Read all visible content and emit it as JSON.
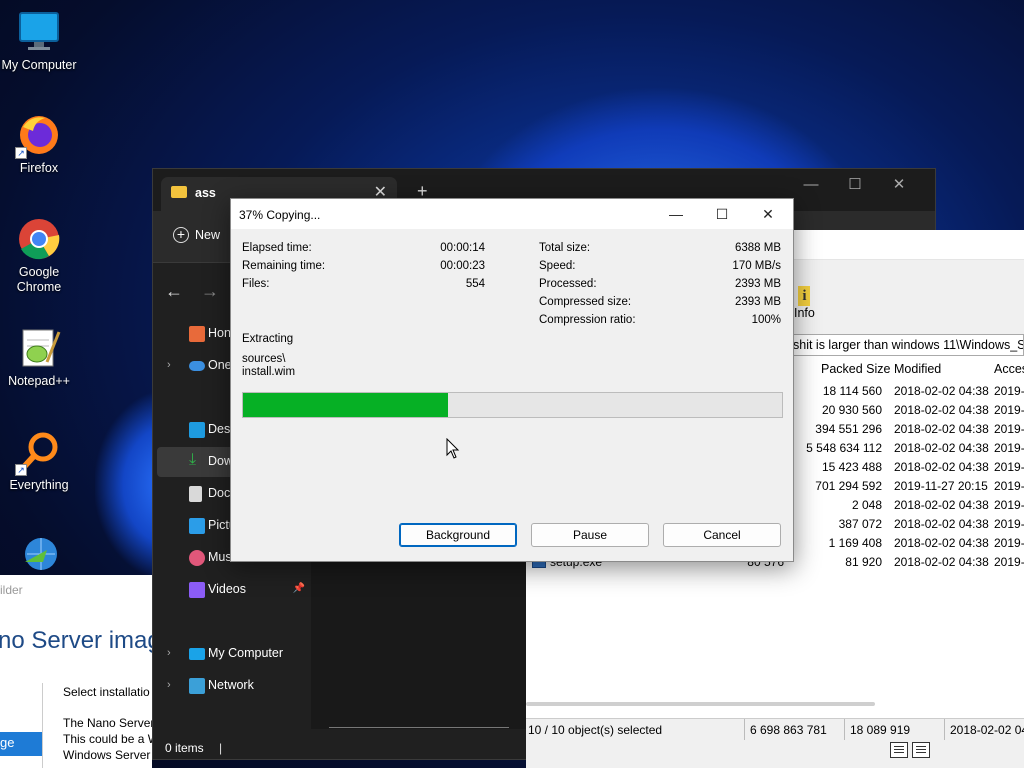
{
  "desktop": {
    "icons": [
      {
        "label": "My Computer",
        "icon": "monitor-icon"
      },
      {
        "label": "Firefox",
        "icon": "firefox-icon"
      },
      {
        "label": "Google Chrome",
        "icon": "chrome-icon"
      },
      {
        "label": "Notepad++",
        "icon": "notepadpp-icon"
      },
      {
        "label": "Everything",
        "icon": "search-icon"
      }
    ]
  },
  "explorer": {
    "tab_title": "ass",
    "new_label": "New",
    "sidebar": [
      {
        "label": "Hon"
      },
      {
        "label": "One"
      },
      {
        "label": "Desk"
      },
      {
        "label": "Dow"
      },
      {
        "label": "Docu"
      },
      {
        "label": "Pictu"
      },
      {
        "label": "Musi"
      },
      {
        "label": "Videos"
      },
      {
        "label": "My Computer"
      },
      {
        "label": "Network"
      }
    ],
    "status": "0 items"
  },
  "sevenzip": {
    "info_label": "Info",
    "path": "shit is larger than windows 11\\Windows_Ser",
    "columns": {
      "packed": "Packed Size",
      "modified": "Modified",
      "accessed": "Acces"
    },
    "rows": [
      {
        "packed": "18 114 560",
        "modified": "2018-02-02 04:38",
        "accessed": "2019-"
      },
      {
        "packed": "20 930 560",
        "modified": "2018-02-02 04:38",
        "accessed": "2019-"
      },
      {
        "packed": "394 551 296",
        "modified": "2018-02-02 04:38",
        "accessed": "2019-"
      },
      {
        "packed": "5 548 634 112",
        "modified": "2018-02-02 04:38",
        "accessed": "2019-"
      },
      {
        "packed": "15 423 488",
        "modified": "2018-02-02 04:38",
        "accessed": "2019-"
      },
      {
        "packed": "701 294 592",
        "modified": "2019-11-27 20:15",
        "accessed": "2019-"
      },
      {
        "packed": "2 048",
        "modified": "2018-02-02 04:38",
        "accessed": "2019-"
      },
      {
        "packed": "387 072",
        "modified": "2018-02-02 04:38",
        "accessed": "2019-"
      },
      {
        "packed": "1 169 408",
        "modified": "2018-02-02 04:38",
        "accessed": "2019-"
      },
      {
        "name": "setup.exe",
        "size": "80 576",
        "packed": "81 920",
        "modified": "2018-02-02 04:38",
        "accessed": "2019-"
      }
    ],
    "status": {
      "selected": "10 / 10 object(s) selected",
      "total_size": "6 698 863 781",
      "packed_size": "18 089 919",
      "date": "2018-02-02 04"
    }
  },
  "setup_dialog": {
    "title": "ilder",
    "heading": "no Server image",
    "line1": "Select installatio",
    "line2": "The Nano Server",
    "line3": "This could be a W",
    "line4": "Windows Server",
    "selected_item": "ge"
  },
  "copy_dialog": {
    "title": "37% Copying...",
    "left_stats": [
      {
        "label": "Elapsed time:",
        "value": "00:00:14"
      },
      {
        "label": "Remaining time:",
        "value": "00:00:23"
      },
      {
        "label": "Files:",
        "value": "554"
      }
    ],
    "right_stats": [
      {
        "label": "Total size:",
        "value": "6388 MB"
      },
      {
        "label": "Speed:",
        "value": "170 MB/s"
      },
      {
        "label": "Processed:",
        "value": "2393 MB"
      },
      {
        "label": "Compressed size:",
        "value": "2393 MB"
      },
      {
        "label": "Compression ratio:",
        "value": "100%"
      }
    ],
    "operation": "Extracting",
    "current_path_line1": "sources\\",
    "current_path_line2": "install.wim",
    "progress": 0.38,
    "progress_color": "#06b025",
    "buttons": {
      "background": "Background",
      "pause": "Pause",
      "cancel": "Cancel"
    }
  }
}
